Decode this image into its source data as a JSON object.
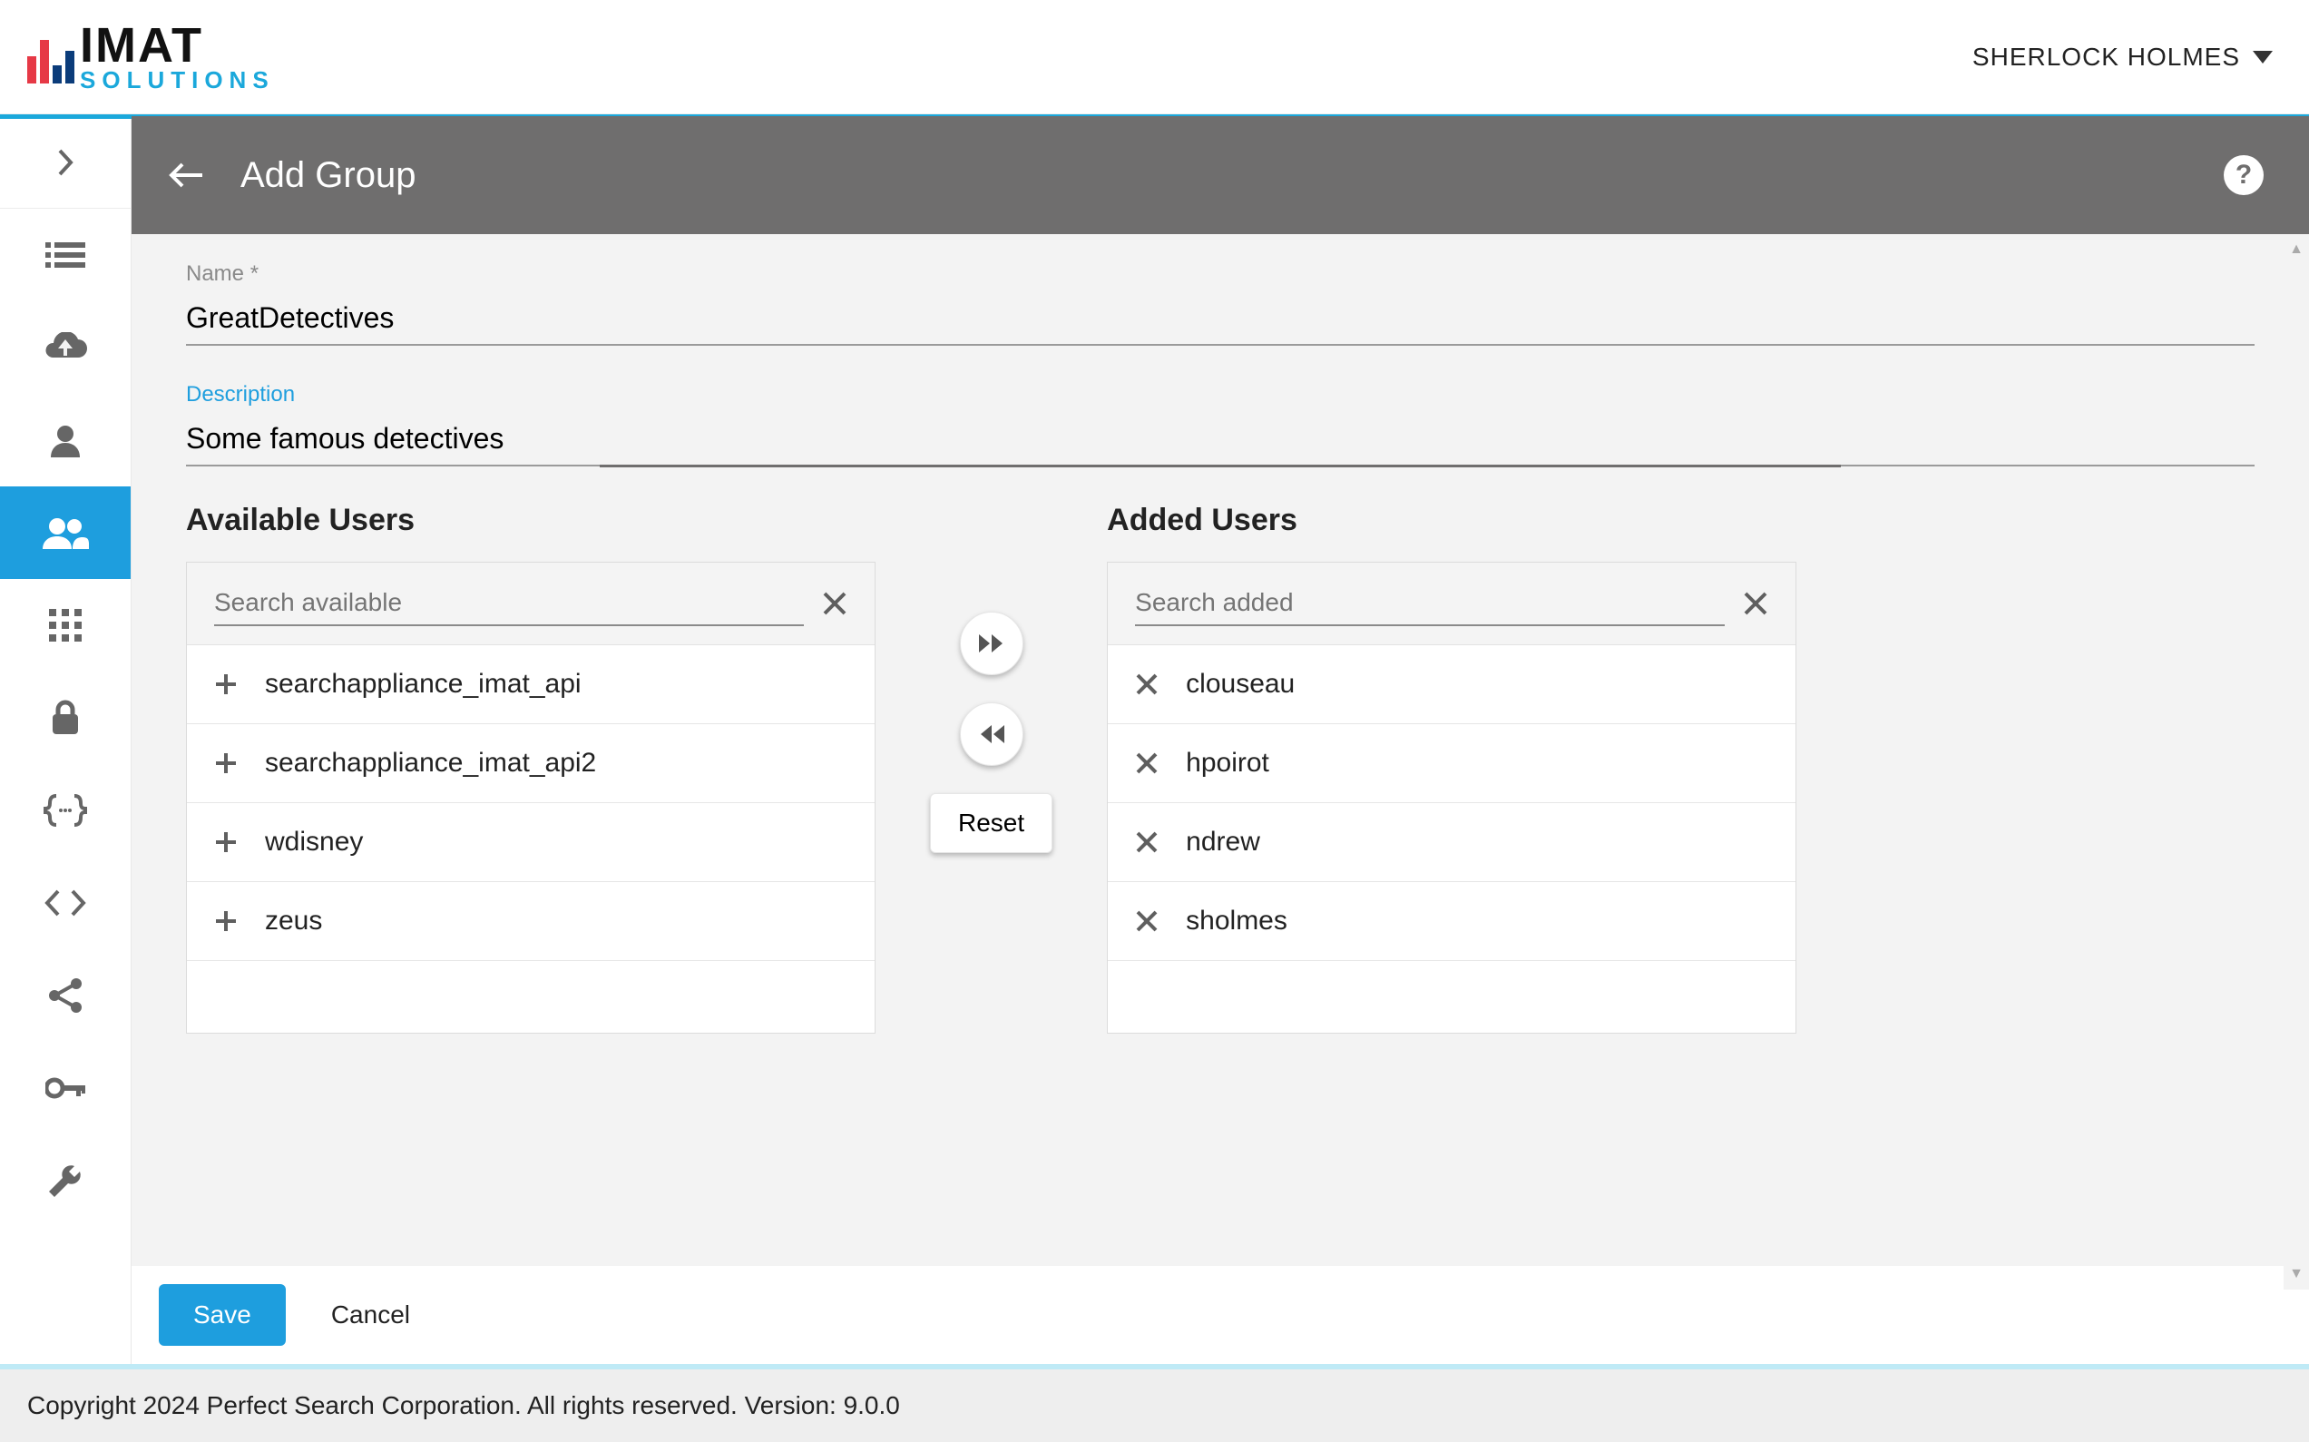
{
  "header": {
    "logo_top": "IMAT",
    "logo_bottom": "SOLUTIONS",
    "user_name": "SHERLOCK HOLMES"
  },
  "page": {
    "title": "Add Group"
  },
  "form": {
    "name_label": "Name *",
    "name_value": "GreatDetectives",
    "desc_label": "Description",
    "desc_value": "Some famous detectives"
  },
  "available": {
    "title": "Available Users",
    "search_placeholder": "Search available",
    "items": [
      "searchappliance_imat_api",
      "searchappliance_imat_api2",
      "wdisney",
      "zeus"
    ]
  },
  "added": {
    "title": "Added Users",
    "search_placeholder": "Search added",
    "items": [
      "clouseau",
      "hpoirot",
      "ndrew",
      "sholmes"
    ]
  },
  "transfer": {
    "reset_label": "Reset"
  },
  "actions": {
    "save": "Save",
    "cancel": "Cancel"
  },
  "footer": {
    "text": "Copyright 2024 Perfect Search Corporation. All rights reserved. Version: 9.0.0"
  }
}
